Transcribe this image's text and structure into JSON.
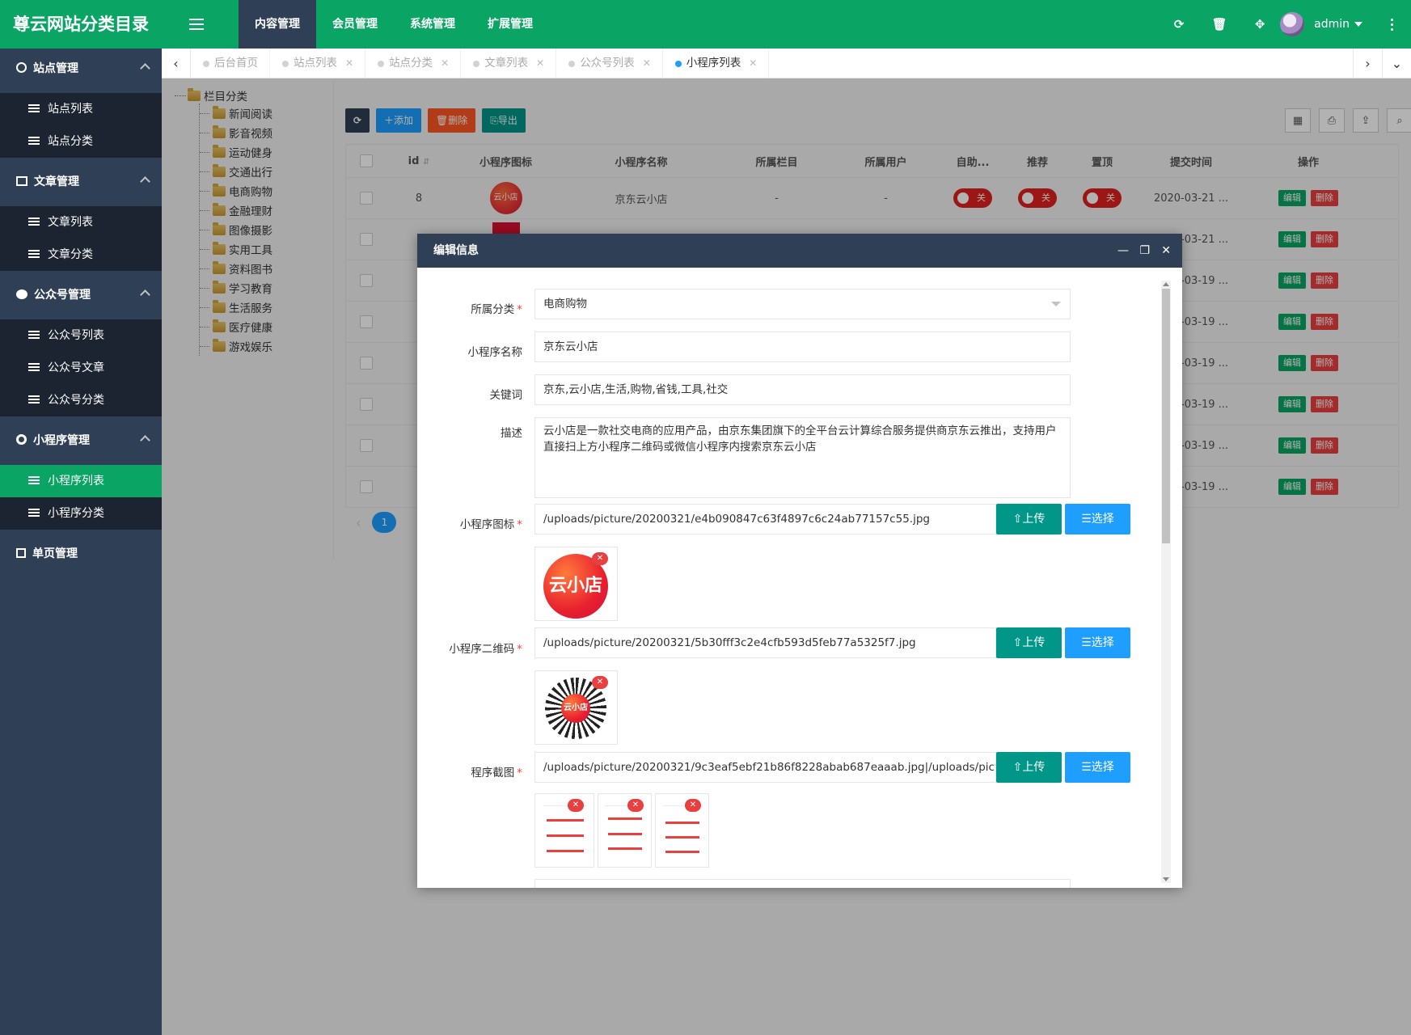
{
  "brand": "尊云网站分类目录",
  "topnav": [
    "内容管理",
    "会员管理",
    "系统管理",
    "扩展管理"
  ],
  "user": {
    "name": "admin"
  },
  "sidebar": {
    "groups": [
      {
        "title": "站点管理",
        "items": [
          "站点列表",
          "站点分类"
        ]
      },
      {
        "title": "文章管理",
        "items": [
          "文章列表",
          "文章分类"
        ]
      },
      {
        "title": "公众号管理",
        "items": [
          "公众号列表",
          "公众号文章",
          "公众号分类"
        ]
      },
      {
        "title": "小程序管理",
        "items": [
          "小程序列表",
          "小程序分类"
        ]
      },
      {
        "title": "单页管理",
        "items": []
      }
    ],
    "active_item": "小程序列表"
  },
  "tabs": [
    "后台首页",
    "站点列表",
    "站点分类",
    "文章列表",
    "公众号列表",
    "小程序列表"
  ],
  "tree": {
    "root": "栏目分类",
    "children": [
      "新闻阅读",
      "影音视频",
      "运动健身",
      "交通出行",
      "电商购物",
      "金融理财",
      "图像摄影",
      "实用工具",
      "资料图书",
      "学习教育",
      "生活服务",
      "医疗健康",
      "游戏娱乐"
    ]
  },
  "toolbar": {
    "add": "添加",
    "delete": "删除",
    "export": "导出"
  },
  "table": {
    "headers": [
      "id",
      "小程序图标",
      "小程序名称",
      "所属栏目",
      "所属用户",
      "自助...",
      "推荐",
      "置顶",
      "提交时间",
      "操作"
    ],
    "rows": [
      {
        "id": "8",
        "icon_text": "云小店",
        "name": "京东云小店",
        "column": "-",
        "user": "-",
        "self": "关",
        "rec": "关",
        "top": "关",
        "time": "2020-03-21 ..."
      },
      {
        "time": "2020-03-21 ..."
      },
      {
        "time": "2020-03-19 ..."
      },
      {
        "time": "2020-03-19 ..."
      },
      {
        "time": "2020-03-19 ..."
      },
      {
        "time": "2020-03-19 ..."
      },
      {
        "time": "2020-03-19 ..."
      },
      {
        "time": "2020-03-19 ..."
      }
    ],
    "edit": "编辑",
    "remove": "删除",
    "page": "1"
  },
  "modal": {
    "title": "编辑信息",
    "fields": {
      "category": {
        "label": "所属分类",
        "value": "电商购物"
      },
      "name": {
        "label": "小程序名称",
        "value": "京东云小店"
      },
      "keywords": {
        "label": "关键词",
        "value": "京东,云小店,生活,购物,省钱,工具,社交"
      },
      "desc": {
        "label": "描述",
        "value": "云小店是一款社交电商的应用产品，由京东集团旗下的全平台云计算综合服务提供商京东云推出，支持用户直接扫上方小程序二维码或微信小程序内搜索京东云小店"
      },
      "icon": {
        "label": "小程序图标",
        "value": "/uploads/picture/20200321/e4b090847c63f4897c6c24ab77157c55.jpg",
        "thumb_text": "云小店"
      },
      "qrcode": {
        "label": "小程序二维码",
        "value": "/uploads/picture/20200321/5b30fff3c2e4cfb593d5feb77a5325f7.jpg",
        "thumb_text": "云小店"
      },
      "screens": {
        "label": "程序截图",
        "value": "/uploads/picture/20200321/9c3eaf5ebf21b86f8228abab687eaaab.jpg|/uploads/picture/2020"
      }
    },
    "upload": "上传",
    "pick": "选择"
  }
}
